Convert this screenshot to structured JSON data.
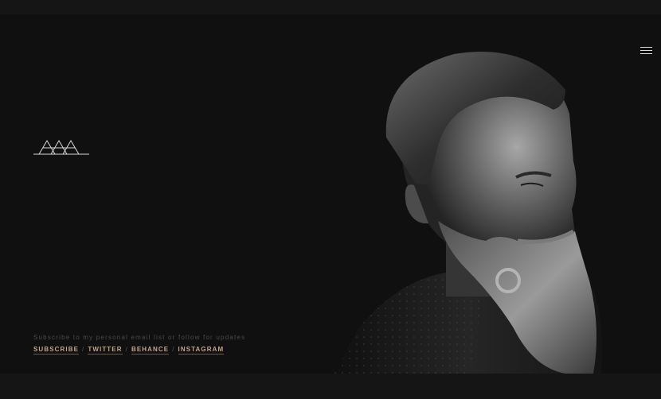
{
  "header": {
    "menu_icon": "hamburger-menu-icon"
  },
  "logo": {
    "icon": "triple-triangle-logo-icon"
  },
  "hero": {
    "image": "bearded-man-portrait"
  },
  "footer": {
    "tagline": "Subscribe to my personal email list or follow for updates",
    "links": [
      {
        "label": "SUBSCRIBE"
      },
      {
        "label": "TWITTER"
      },
      {
        "label": "BEHANCE"
      },
      {
        "label": "INSTAGRAM"
      }
    ],
    "separator": "/"
  },
  "colors": {
    "background": "#101010",
    "frame": "#151515",
    "link": "#c2a58a",
    "tagline": "#4a4a4a"
  }
}
